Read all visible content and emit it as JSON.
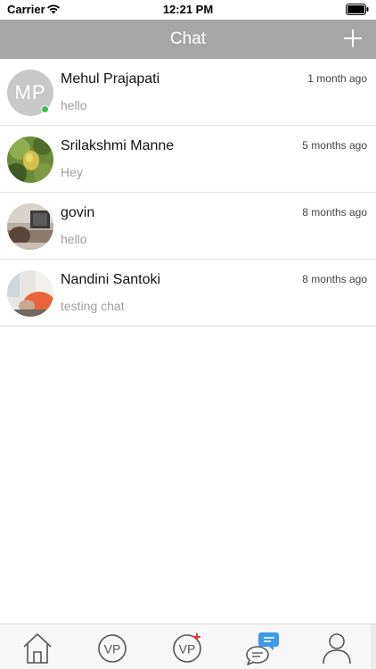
{
  "status_bar": {
    "carrier": "Carrier",
    "time": "12:21 PM"
  },
  "header": {
    "title": "Chat",
    "add_icon": "plus-icon"
  },
  "chats": [
    {
      "name": "Mehul Prajapati",
      "message": "hello",
      "time": "1 month ago",
      "initials": "MP",
      "online": true
    },
    {
      "name": "Srilakshmi Manne",
      "message": "Hey",
      "time": "5 months ago",
      "online": false
    },
    {
      "name": "govin",
      "message": "hello",
      "time": "8 months ago",
      "online": false
    },
    {
      "name": "Nandini Santoki",
      "message": "testing chat",
      "time": "8 months ago",
      "online": false
    }
  ],
  "tabs": [
    {
      "icon": "home-icon",
      "text": ""
    },
    {
      "icon": "vp-icon",
      "text": "VP"
    },
    {
      "icon": "vp-add-icon",
      "text": "VP"
    },
    {
      "icon": "chat-icon",
      "text": "",
      "active": true
    },
    {
      "icon": "profile-icon",
      "text": ""
    }
  ],
  "colors": {
    "header_bg": "#a6a6a6",
    "online": "#3cc24a",
    "chat_accent": "#3d9ae8",
    "vp_badge": "#e23b3b"
  }
}
